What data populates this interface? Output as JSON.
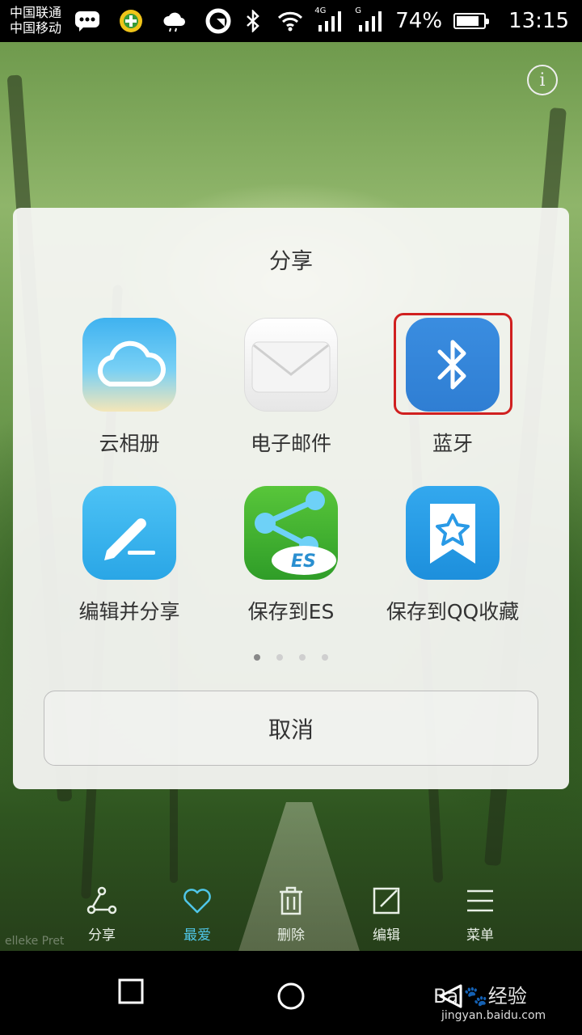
{
  "status_bar": {
    "carrier_1": "中国联通",
    "carrier_2": "中国移动",
    "network_1": "4G",
    "network_2": "G",
    "battery": "74%",
    "battery_level": 0.74,
    "time": "13:15",
    "icons": [
      "message-icon",
      "app-icon",
      "weather-icon",
      "sync-icon",
      "bluetooth-icon",
      "wifi-icon",
      "signal-icon",
      "signal-icon",
      "battery-icon"
    ]
  },
  "dialog": {
    "title": "分享",
    "apps": [
      {
        "label": "云相册",
        "icon": "cloud-album-icon"
      },
      {
        "label": "电子邮件",
        "icon": "email-icon"
      },
      {
        "label": "蓝牙",
        "icon": "bluetooth-icon"
      },
      {
        "label": "编辑并分享",
        "icon": "edit-share-icon"
      },
      {
        "label": "保存到ES",
        "icon": "es-file-icon"
      },
      {
        "label": "保存到QQ收藏",
        "icon": "qq-favorites-icon"
      }
    ],
    "highlight_color": "#d02020",
    "page_count": 4,
    "current_page": 1,
    "cancel": "取消"
  },
  "toolbar": {
    "items": [
      {
        "label": "分享",
        "icon": "share-icon"
      },
      {
        "label": "最爱",
        "icon": "heart-icon"
      },
      {
        "label": "删除",
        "icon": "trash-icon"
      },
      {
        "label": "编辑",
        "icon": "edit-icon"
      },
      {
        "label": "菜单",
        "icon": "menu-icon"
      }
    ],
    "active_color": "#4fc6e8"
  },
  "watermark": {
    "brand": "Bai",
    "brand_cn": "经验",
    "url": "jingyan.baidu.com",
    "photo_text": "elleke Pret"
  }
}
